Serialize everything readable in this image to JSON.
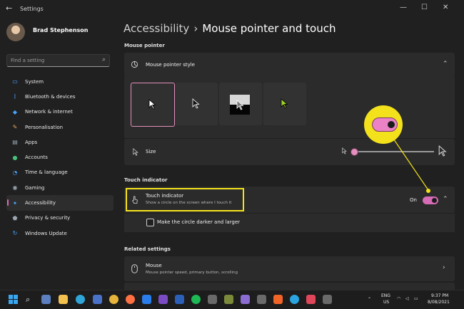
{
  "window": {
    "title": "Settings",
    "back_glyph": "←",
    "min_glyph": "—",
    "max_glyph": "☐",
    "close_glyph": "✕"
  },
  "user": {
    "name": "Brad Stephenson"
  },
  "search": {
    "placeholder": "Find a setting"
  },
  "sidebar": {
    "items": [
      {
        "label": "System",
        "icon": "monitor-icon",
        "color": "#4aa3ff"
      },
      {
        "label": "Bluetooth & devices",
        "icon": "bluetooth-icon",
        "color": "#4aa3ff"
      },
      {
        "label": "Network & internet",
        "icon": "wifi-icon",
        "color": "#4aa3ff"
      },
      {
        "label": "Personalisation",
        "icon": "brush-icon",
        "color": "#e8a060"
      },
      {
        "label": "Apps",
        "icon": "apps-icon",
        "color": "#9aa6b2"
      },
      {
        "label": "Accounts",
        "icon": "person-icon",
        "color": "#48c07a"
      },
      {
        "label": "Time & language",
        "icon": "globe-clock-icon",
        "color": "#4aa3ff"
      },
      {
        "label": "Gaming",
        "icon": "gamepad-icon",
        "color": "#9aa6b2"
      },
      {
        "label": "Accessibility",
        "icon": "accessibility-icon",
        "color": "#4aa3ff",
        "active": true
      },
      {
        "label": "Privacy & security",
        "icon": "shield-icon",
        "color": "#9aa6b2"
      },
      {
        "label": "Windows Update",
        "icon": "update-icon",
        "color": "#4aa3ff"
      }
    ]
  },
  "header": {
    "crumb": "Accessibility",
    "separator": "›",
    "title": "Mouse pointer and touch"
  },
  "mouse_pointer": {
    "section_label": "Mouse pointer",
    "style_label": "Mouse pointer style",
    "size_label": "Size",
    "size_value": 0.02,
    "selected_style_index": 0
  },
  "touch": {
    "section_label": "Touch indicator",
    "title": "Touch indicator",
    "subtitle": "Show a circle on the screen where I touch it",
    "state_label": "On",
    "darker_label": "Make the circle darker and larger"
  },
  "related": {
    "section_label": "Related settings",
    "mouse_title": "Mouse",
    "mouse_subtitle": "Mouse pointer speed, primary button, scrolling"
  },
  "accent_color": "#d66bb6",
  "highlight_color": "#f3e21b",
  "taskbar": {
    "lang1": "ENG",
    "lang2": "US",
    "time": "9:37 PM",
    "date": "8/08/2021"
  }
}
